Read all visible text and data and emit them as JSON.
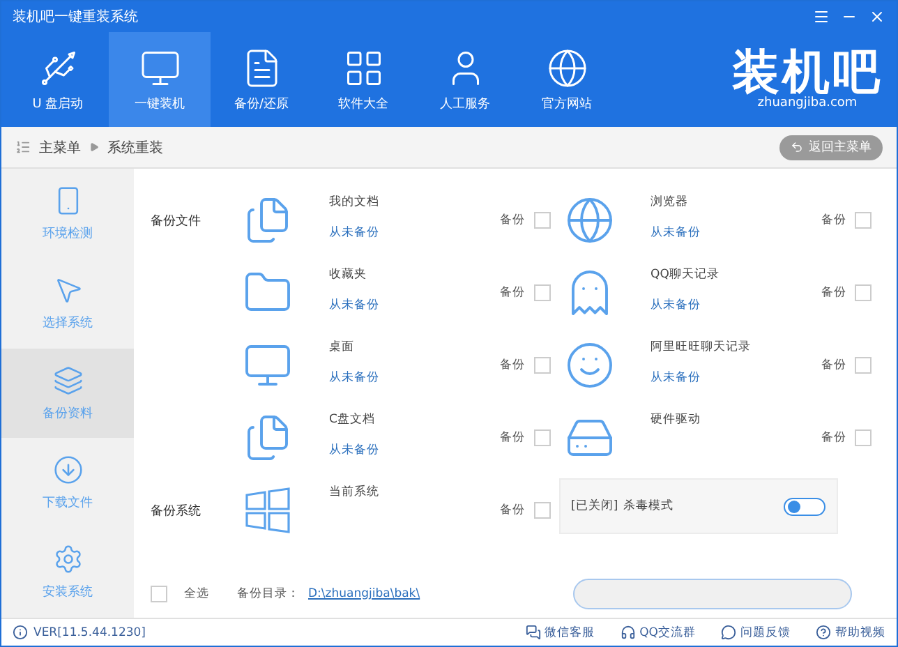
{
  "window": {
    "title": "装机吧一键重装系统"
  },
  "nav": [
    {
      "label": "U 盘启动",
      "selected": false
    },
    {
      "label": "一键装机",
      "selected": true
    },
    {
      "label": "备份/还原",
      "selected": false
    },
    {
      "label": "软件大全",
      "selected": false
    },
    {
      "label": "人工服务",
      "selected": false
    },
    {
      "label": "官方网站",
      "selected": false
    }
  ],
  "logo": {
    "name": "装机吧",
    "site": "zhuangjiba.com"
  },
  "breadcrumb": [
    "主菜单",
    "系统重装"
  ],
  "back_button": "返回主菜单",
  "sidebar": [
    {
      "label": "环境检测",
      "selected": false
    },
    {
      "label": "选择系统",
      "selected": false
    },
    {
      "label": "备份资料",
      "selected": true
    },
    {
      "label": "下载文件",
      "selected": false
    },
    {
      "label": "安装系统",
      "selected": false
    }
  ],
  "file_section": {
    "label": "备份文件",
    "items": [
      {
        "kind": "documents",
        "name": "我的文档",
        "status": "从未备份",
        "check_label": "备份",
        "checked": false
      },
      {
        "kind": "browser",
        "name": "浏览器",
        "status": "从未备份",
        "check_label": "备份",
        "checked": false
      },
      {
        "kind": "folder",
        "name": "收藏夹",
        "status": "从未备份",
        "check_label": "备份",
        "checked": false
      },
      {
        "kind": "chat",
        "name": "QQ聊天记录",
        "status": "从未备份",
        "check_label": "备份",
        "checked": false
      },
      {
        "kind": "desktop",
        "name": "桌面",
        "status": "从未备份",
        "check_label": "备份",
        "checked": false
      },
      {
        "kind": "messenger",
        "name": "阿里旺旺聊天记录",
        "status": "从未备份",
        "check_label": "备份",
        "checked": false
      },
      {
        "kind": "documents",
        "name": "C盘文档",
        "status": "从未备份",
        "check_label": "备份",
        "checked": false
      },
      {
        "kind": "hardware",
        "name": "硬件驱动",
        "check_label": "备份",
        "checked": false
      }
    ]
  },
  "system_section": {
    "label": "备份系统",
    "name": "当前系统",
    "check_label": "备份",
    "checked": false,
    "antivirus": {
      "state": "[已关闭]",
      "label": "杀毒模式",
      "on": false
    }
  },
  "select_all": {
    "label": "全选",
    "checked": false
  },
  "backup_dir": {
    "label": "备份目录：",
    "path": "D:\\zhuangjiba\\bak\\"
  },
  "footer": {
    "version": "VER[11.5.44.1230]",
    "links": [
      "微信客服",
      "QQ交流群",
      "问题反馈",
      "帮助视频"
    ]
  }
}
